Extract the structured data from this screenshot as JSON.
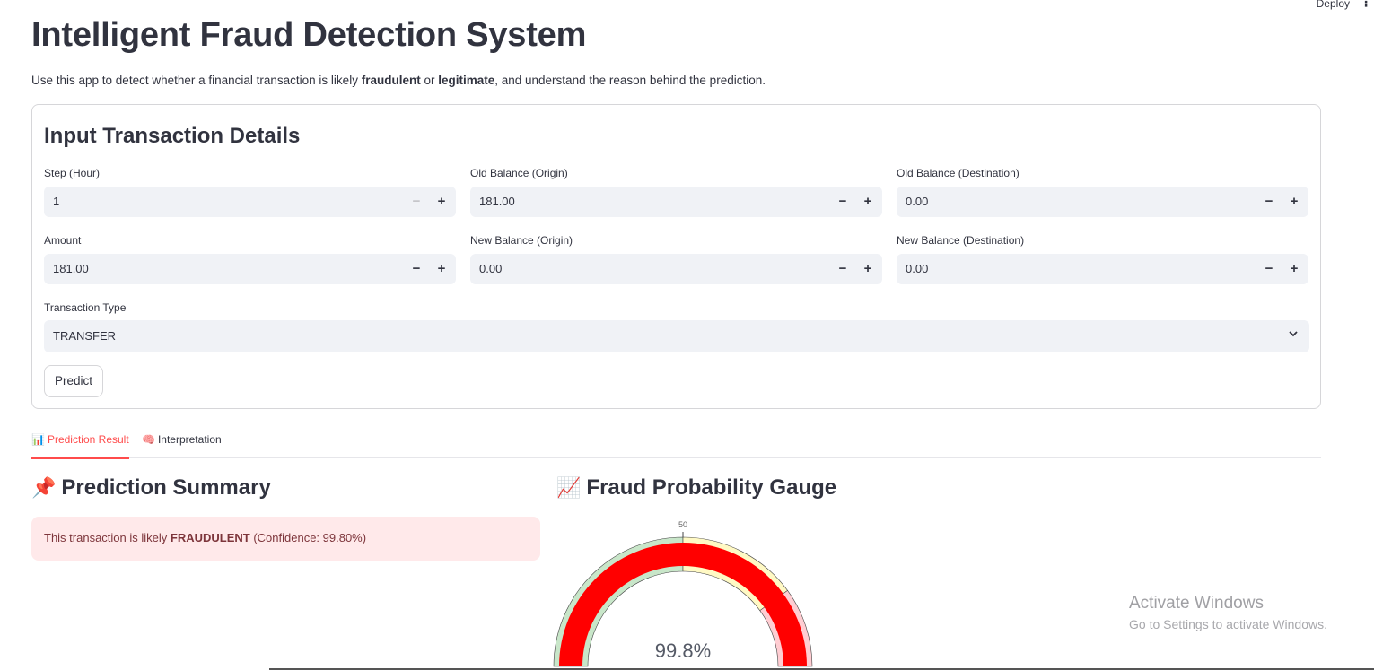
{
  "header": {
    "deploy_label": "Deploy",
    "menu_icon": "⋮"
  },
  "page": {
    "title": "Intelligent Fraud Detection System",
    "intro_pre": "Use this app to detect whether a financial transaction is likely ",
    "intro_b1": "fraudulent",
    "intro_mid": " or ",
    "intro_b2": "legitimate",
    "intro_post": ", and understand the reason behind the prediction."
  },
  "form": {
    "heading": "Input Transaction Details",
    "fields": [
      {
        "label": "Step (Hour)",
        "value": "1"
      },
      {
        "label": "Old Balance (Origin)",
        "value": "181.00"
      },
      {
        "label": "Old Balance (Destination)",
        "value": "0.00"
      },
      {
        "label": "Amount",
        "value": "181.00"
      },
      {
        "label": "New Balance (Origin)",
        "value": "0.00"
      },
      {
        "label": "New Balance (Destination)",
        "value": "0.00"
      }
    ],
    "minus": "−",
    "plus": "+",
    "type_label": "Transaction Type",
    "type_value": "TRANSFER",
    "predict_label": "Predict"
  },
  "tabs": [
    {
      "icon": "📊",
      "label": "Prediction Result"
    },
    {
      "icon": "🧠",
      "label": "Interpretation"
    }
  ],
  "summary": {
    "icon": "📌",
    "heading": "Prediction Summary",
    "alert_pre": "This transaction is likely ",
    "alert_bold": "FRAUDULENT",
    "alert_post": " (Confidence: 99.80%)"
  },
  "gauge": {
    "icon": "📈",
    "heading": "Fraud Probability Gauge",
    "tick_label": "50",
    "value_text": "99.8%",
    "value": 99.8,
    "min": 0,
    "max": 100,
    "bands": [
      {
        "from": 0,
        "to": 50,
        "color": "#c8e6c9"
      },
      {
        "from": 50,
        "to": 80,
        "color": "#fff9c4"
      },
      {
        "from": 80,
        "to": 100,
        "color": "#ffcdd2"
      }
    ],
    "bar_color": "#ff0000"
  },
  "watermark": {
    "line1": "Activate Windows",
    "line2": "Go to Settings to activate Windows."
  }
}
